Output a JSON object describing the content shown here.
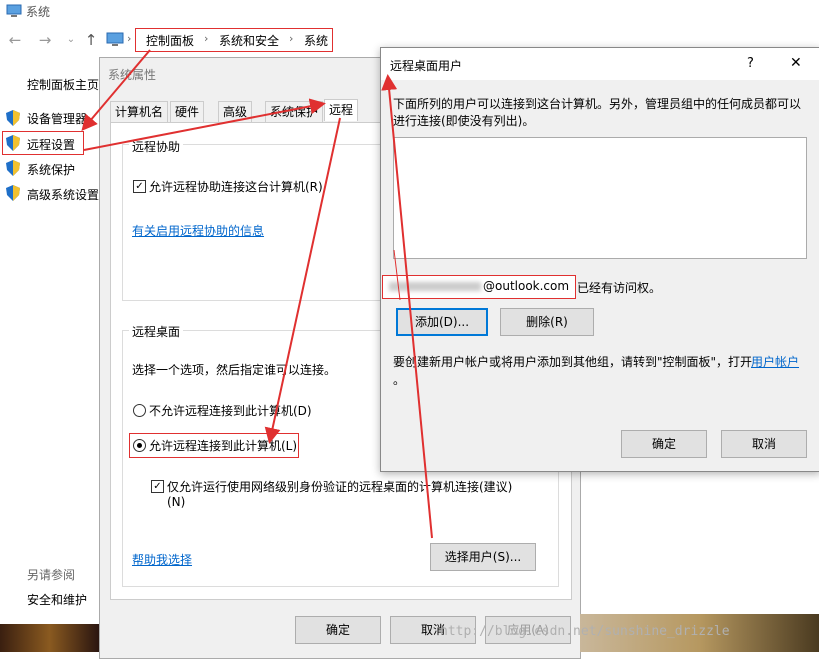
{
  "window": {
    "title": "系统"
  },
  "breadcrumb": [
    "控制面板",
    "系统和安全",
    "系统"
  ],
  "left_panel": {
    "home": "控制面板主页",
    "links": [
      "设备管理器",
      "远程设置",
      "系统保护",
      "高级系统设置"
    ],
    "see_also_title": "另请参阅",
    "see_also": [
      "安全和维护"
    ]
  },
  "sysprop": {
    "title": "系统属性",
    "tabs": [
      "计算机名",
      "硬件",
      "高级",
      "系统保护",
      "远程"
    ],
    "remote_assist": {
      "group": "远程协助",
      "checkbox": "允许远程协助连接这台计算机(R)",
      "link": "有关启用远程协助的信息"
    },
    "remote_desktop": {
      "group": "远程桌面",
      "instruction": "选择一个选项，然后指定谁可以连接。",
      "option_deny": "不允许远程连接到此计算机(D)",
      "option_allow": "允许远程连接到此计算机(L)",
      "nla_checkbox": "仅允许运行使用网络级别身份验证的远程桌面的计算机连接(建议)",
      "nla_checkbox_line2": "(N)",
      "help_link": "帮助我选择",
      "select_users": "选择用户(S)..."
    },
    "buttons": {
      "ok": "确定",
      "cancel": "取消",
      "apply": "应用(A)"
    }
  },
  "remote_users": {
    "title": "远程桌面用户",
    "help": "?",
    "close": "✕",
    "description": "下面所列的用户可以连接到这台计算机。另外，管理员组中的任何成员都可以进行连接(即使没有列出)。",
    "user_email": "@outlook.com",
    "access_text": "已经有访问权。",
    "add": "添加(D)...",
    "remove": "删除(R)",
    "footer_text": "要创建新用户帐户或将用户添加到其他组，请转到\"控制面板\"，打开",
    "footer_link": "用户帐户",
    "footer_end": "。",
    "ok": "确定",
    "cancel": "取消"
  },
  "watermark": "http://blog.csdn.net/sunshine_drizzle"
}
